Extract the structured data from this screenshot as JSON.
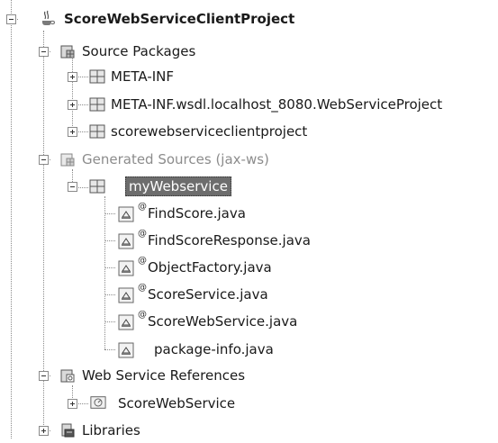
{
  "project": {
    "name": "ScoreWebServiceClientProject",
    "source_packages": {
      "label": "Source Packages",
      "packages": [
        {
          "label": "META-INF"
        },
        {
          "label": "META-INF.wsdl.localhost_8080.WebServiceProject"
        },
        {
          "label": "scorewebserviceclientproject"
        }
      ]
    },
    "generated_sources": {
      "label": "Generated Sources (jax-ws)",
      "package": {
        "label": "myWebservice",
        "files": [
          {
            "label": "FindScore.java"
          },
          {
            "label": "FindScoreResponse.java"
          },
          {
            "label": "ObjectFactory.java"
          },
          {
            "label": "ScoreService.java"
          },
          {
            "label": "ScoreWebService.java"
          },
          {
            "label": "package-info.java"
          }
        ]
      }
    },
    "web_service_references": {
      "label": "Web Service References",
      "items": [
        {
          "label": "ScoreWebService"
        }
      ]
    },
    "libraries": {
      "label": "Libraries"
    }
  }
}
